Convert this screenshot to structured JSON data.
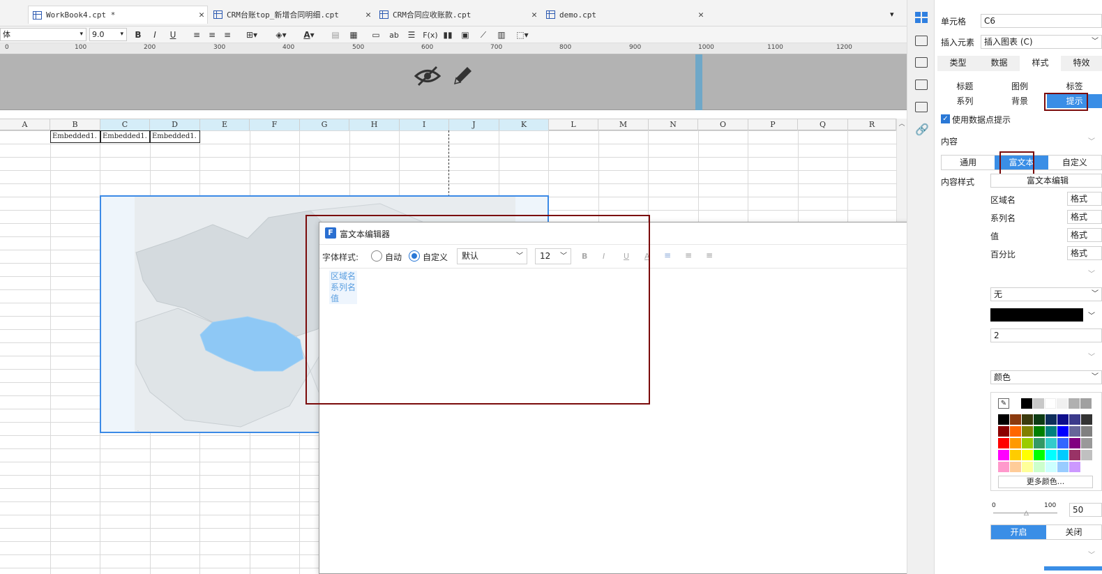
{
  "tabs": [
    {
      "label": "WorkBook4.cpt *",
      "active": true
    },
    {
      "label": "CRM台账top_新增合同明细.cpt",
      "active": false
    },
    {
      "label": "CRM合同应收账款.cpt",
      "active": false
    },
    {
      "label": "demo.cpt",
      "active": false
    }
  ],
  "toolbar": {
    "font_family": "体",
    "font_size": "9.0",
    "bold": "B",
    "italic": "I",
    "underline": "U",
    "text_btn": "ab",
    "formula_btn": "F(x)"
  },
  "ruler_ticks": [
    "0",
    "100",
    "200",
    "300",
    "400",
    "500",
    "600",
    "700",
    "800",
    "900",
    "1000",
    "1100",
    "1200"
  ],
  "columns": [
    "A",
    "B",
    "C",
    "D",
    "E",
    "F",
    "G",
    "H",
    "I",
    "J",
    "K",
    "L",
    "M",
    "N",
    "O",
    "P",
    "Q",
    "R"
  ],
  "cells": {
    "b1": "Embedded1.",
    "c1": "Embedded1.",
    "d1": "Embedded1."
  },
  "dialog": {
    "title": "富文本编辑器",
    "font_style_label": "字体样式:",
    "radio_auto": "自动",
    "radio_custom": "自定义",
    "font_select": "默认",
    "size_select": "12",
    "fmt_bold": "B",
    "fmt_italic": "I",
    "fmt_underline": "U",
    "fmt_strike": "A",
    "content_lines": [
      "区域名",
      "系列名",
      "值"
    ]
  },
  "panel": {
    "cell_label": "单元格",
    "cell_value": "C6",
    "insert_label": "插入元素",
    "insert_value": "插入图表 (C)",
    "tabs": [
      "类型",
      "数据",
      "样式",
      "特效"
    ],
    "active_tab": "样式",
    "subtabs_row1": [
      "标题",
      "图例",
      "标签"
    ],
    "subtabs_row2": [
      "系列",
      "背景",
      "提示"
    ],
    "active_subtab": "提示",
    "use_tooltip": "使用数据点提示",
    "content_section": "内容",
    "content_modes": [
      "通用",
      "富文本",
      "自定义"
    ],
    "active_mode": "富文本",
    "content_style_label": "内容样式",
    "rich_edit_btn": "富文本编辑",
    "fields": [
      {
        "label": "区域名",
        "btn": "格式"
      },
      {
        "label": "系列名",
        "btn": "格式"
      },
      {
        "label": "值",
        "btn": "格式"
      },
      {
        "label": "百分比",
        "btn": "格式"
      }
    ],
    "border_select": "无",
    "border_width": "2",
    "bg_select": "颜色",
    "more_colors": "更多颜色...",
    "opacity_min": "0",
    "opacity_max": "100",
    "opacity_value": "50",
    "toggle_on": "开启",
    "toggle_off": "关闭"
  },
  "colors": {
    "accent": "#3a8ee6",
    "highlight_box": "#7a0a0a",
    "map_region": "#8ec8f5",
    "map_land": "#dde3e8"
  }
}
